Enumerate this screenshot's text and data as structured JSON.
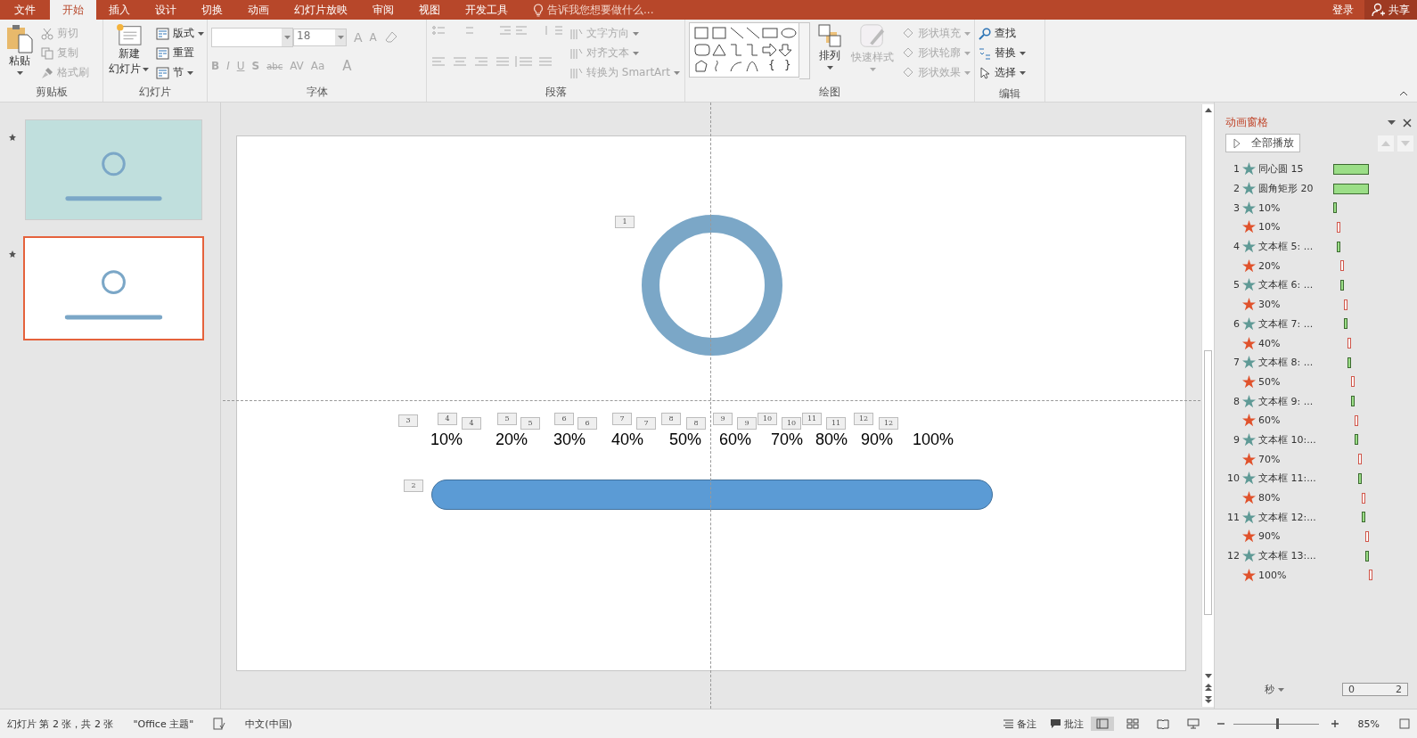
{
  "title_bar": {
    "tabs": [
      {
        "label": "文件",
        "selected": false
      },
      {
        "label": "开始",
        "selected": true
      },
      {
        "label": "插入",
        "selected": false
      },
      {
        "label": "设计",
        "selected": false
      },
      {
        "label": "切换",
        "selected": false
      },
      {
        "label": "动画",
        "selected": false
      },
      {
        "label": "幻灯片放映",
        "selected": false
      },
      {
        "label": "审阅",
        "selected": false
      },
      {
        "label": "视图",
        "selected": false
      },
      {
        "label": "开发工具",
        "selected": false
      }
    ],
    "tell_me": "告诉我您想要做什么...",
    "sign_in": "登录",
    "share": "共享"
  },
  "ribbon": {
    "clipboard": {
      "label": "剪贴板",
      "paste": "粘贴",
      "items": [
        {
          "label": "剪切",
          "disabled": true
        },
        {
          "label": "复制",
          "disabled": true
        },
        {
          "label": "格式刷",
          "disabled": true
        }
      ]
    },
    "slides": {
      "label": "幻灯片",
      "new_slide": [
        "新建",
        "幻灯片"
      ],
      "items": [
        {
          "label": "版式",
          "disabled": false
        },
        {
          "label": "重置",
          "disabled": false
        },
        {
          "label": "节",
          "disabled": false
        }
      ]
    },
    "font": {
      "label": "字体",
      "disabled": true,
      "font_size": "18",
      "size_buttons": [
        "A",
        "A"
      ],
      "format_buttons": [
        "B",
        "I",
        "U",
        "S",
        "abc",
        "AV",
        "Aa",
        "A"
      ]
    },
    "paragraph": {
      "label": "段落",
      "disabled": true,
      "items": [
        "文字方向",
        "对齐文本",
        "转换为 SmartArt"
      ]
    },
    "drawing": {
      "label": "绘图",
      "arrange": "排列",
      "quick_styles": "快速样式",
      "quick_styles_disabled": true,
      "items": [
        {
          "label": "形状填充",
          "disabled": true
        },
        {
          "label": "形状轮廓",
          "disabled": true
        },
        {
          "label": "形状效果",
          "disabled": true
        }
      ],
      "shape_glyphs": [
        "{",
        "}"
      ]
    },
    "editing": {
      "label": "编辑",
      "items": [
        "查找",
        "替换",
        "选择"
      ]
    }
  },
  "thumbnails": [
    {
      "selected": false,
      "color": "#c0dfdd"
    },
    {
      "selected": true,
      "color": "#ffffff"
    }
  ],
  "slide": {
    "percent_labels": [
      "10%",
      "20%",
      "30%",
      "40%",
      "50%",
      "60%",
      "70%",
      "80%",
      "90%",
      "100%"
    ],
    "animation_tags": [
      "1",
      "3",
      "4",
      "4",
      "5",
      "5",
      "6",
      "6",
      "7",
      "7",
      "8",
      "8",
      "9",
      "9",
      "10",
      "10",
      "11",
      "11",
      "12",
      "12",
      "2"
    ]
  },
  "animation_pane": {
    "title": "动画窗格",
    "play_all": "全部播放",
    "items": [
      {
        "number": "1",
        "kind": "entrance",
        "label": "同心圆 15",
        "long": true
      },
      {
        "number": "2",
        "kind": "entrance",
        "label": "圆角矩形 20",
        "long": true
      },
      {
        "number": "3",
        "kind": "entrance",
        "label": "10%",
        "long": false
      },
      {
        "kind": "emphasis",
        "label": "10%",
        "long": false
      },
      {
        "number": "4",
        "kind": "entrance",
        "label": "文本框 5: ...",
        "long": false
      },
      {
        "kind": "emphasis",
        "label": "20%",
        "long": false
      },
      {
        "number": "5",
        "kind": "entrance",
        "label": "文本框 6: ...",
        "long": false
      },
      {
        "kind": "emphasis",
        "label": "30%",
        "long": false
      },
      {
        "number": "6",
        "kind": "entrance",
        "label": "文本框 7: ...",
        "long": false
      },
      {
        "kind": "emphasis",
        "label": "40%",
        "long": false
      },
      {
        "number": "7",
        "kind": "entrance",
        "label": "文本框 8: ...",
        "long": false
      },
      {
        "kind": "emphasis",
        "label": "50%",
        "long": false
      },
      {
        "number": "8",
        "kind": "entrance",
        "label": "文本框 9: ...",
        "long": false
      },
      {
        "kind": "emphasis",
        "label": "60%",
        "long": false
      },
      {
        "number": "9",
        "kind": "entrance",
        "label": "文本框 10:...",
        "long": false
      },
      {
        "kind": "emphasis",
        "label": "70%",
        "long": false
      },
      {
        "number": "10",
        "kind": "entrance",
        "label": "文本框 11:...",
        "long": false
      },
      {
        "kind": "emphasis",
        "label": "80%",
        "long": false
      },
      {
        "number": "11",
        "kind": "entrance",
        "label": "文本框 12:...",
        "long": false
      },
      {
        "kind": "emphasis",
        "label": "90%",
        "long": false
      },
      {
        "number": "12",
        "kind": "entrance",
        "label": "文本框 13:...",
        "long": false
      },
      {
        "kind": "emphasis",
        "label": "100%",
        "long": false
      }
    ],
    "time_unit": "秒",
    "timeline": [
      "0",
      "2"
    ]
  },
  "status_bar": {
    "slide_info": "幻灯片 第 2 张，共 2 张",
    "theme": "\"Office 主题\"",
    "language": "中文(中国)",
    "notes": "备注",
    "comments": "批注",
    "zoom": "85%",
    "zoom_level": {
      "level": 0.5
    }
  }
}
